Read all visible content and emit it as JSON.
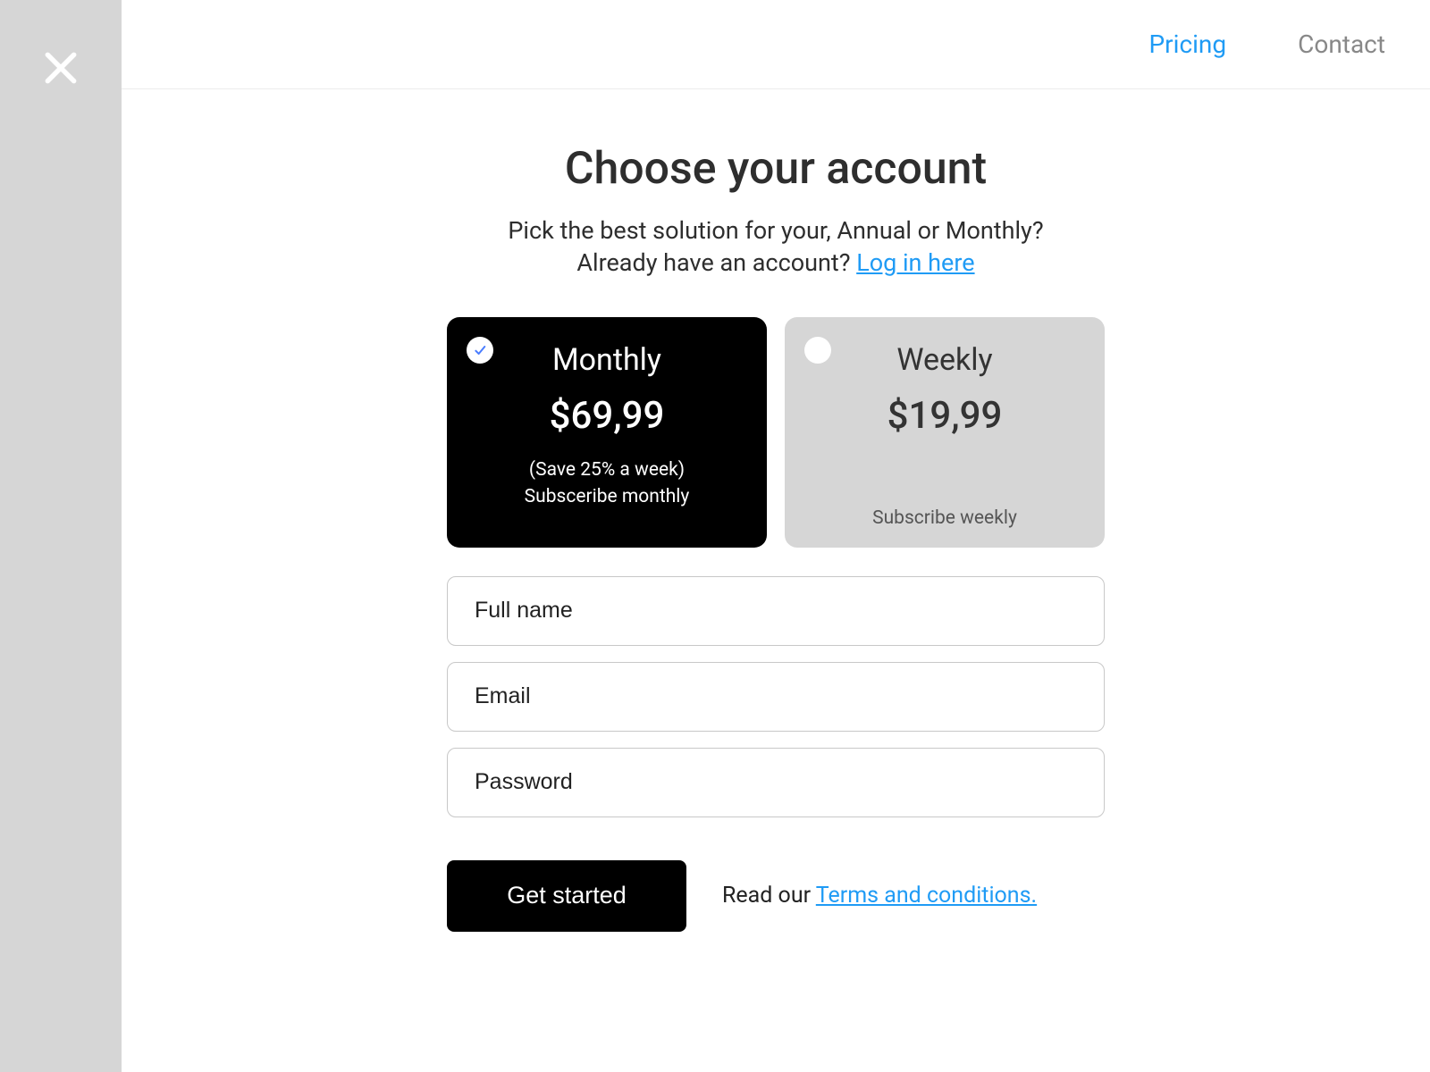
{
  "topnav": {
    "pricing_label": "Pricing",
    "contact_label": "Contact"
  },
  "header": {
    "title": "Choose your account",
    "subtitle_line1": "Pick the best solution for your, Annual or Monthly?",
    "subtitle_line2_prefix": "Already have an account? ",
    "login_link_label": "Log in here"
  },
  "plans": {
    "monthly": {
      "title": "Monthly",
      "price": "$69,99",
      "save_note": "(Save 25% a week)",
      "subscribe_label": "Subsceribe monthly",
      "selected": true
    },
    "weekly": {
      "title": "Weekly",
      "price": "$19,99",
      "subscribe_label": "Subscribe weekly",
      "selected": false
    }
  },
  "form": {
    "fullname_placeholder": "Full name",
    "email_placeholder": "Email",
    "password_placeholder": "Password"
  },
  "footer": {
    "get_started_label": "Get started",
    "read_our_prefix": "Read our ",
    "terms_link_label": "Terms and conditions."
  }
}
